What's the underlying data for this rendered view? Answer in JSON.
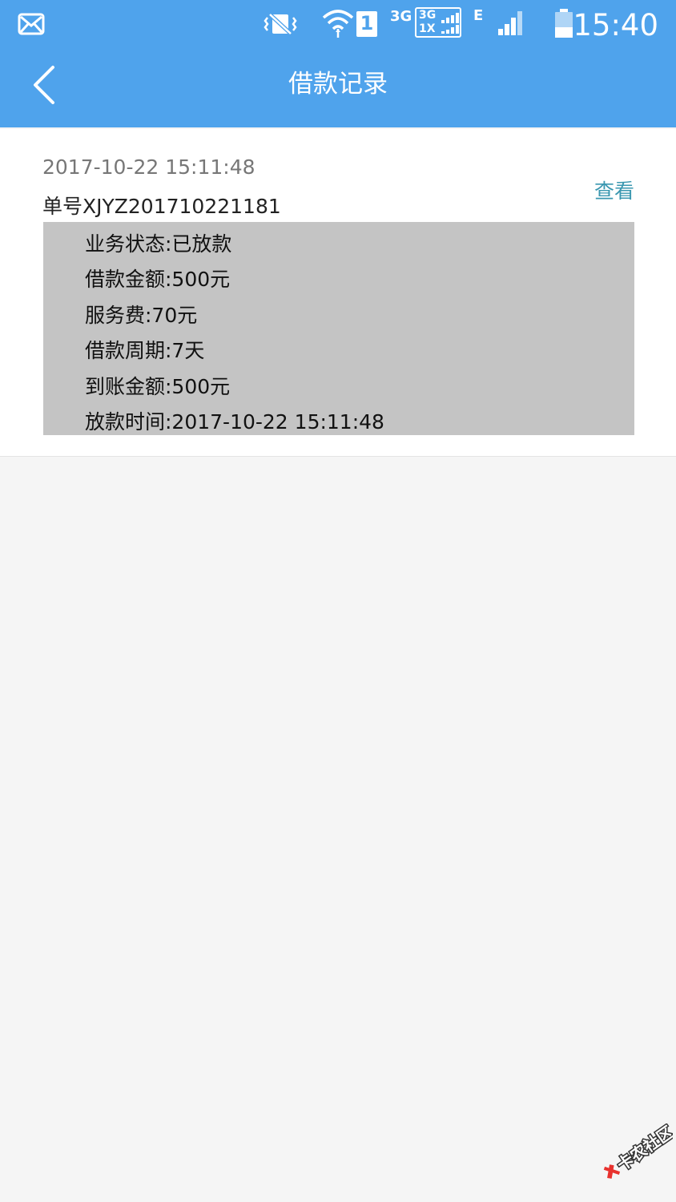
{
  "status_bar": {
    "time": "15:40",
    "network_3g": "3G",
    "network_dual_top": "3G",
    "network_dual_bottom": "1X",
    "network_e": "E",
    "sim_slot": "1",
    "icons": [
      "mail-icon",
      "vibrate-icon",
      "wifi-icon",
      "sim-icon",
      "signal-icon",
      "signal-icon",
      "battery-icon"
    ]
  },
  "header": {
    "title": "借款记录",
    "back_icon": "chevron-left-icon",
    "background_color": "#4fa3ec"
  },
  "record": {
    "datetime": "2017-10-22 15:11:48",
    "order_no": "单号XJYZ201710221181",
    "view_label": "查看",
    "view_color": "#3a97b0",
    "details": [
      "业务状态:已放款",
      "借款金额:500元",
      "服务费:70元",
      "借款周期:7天",
      "到账金额:500元",
      "放款时间:2017-10-22 15:11:48"
    ]
  },
  "watermark": {
    "text": "卡农社区"
  }
}
